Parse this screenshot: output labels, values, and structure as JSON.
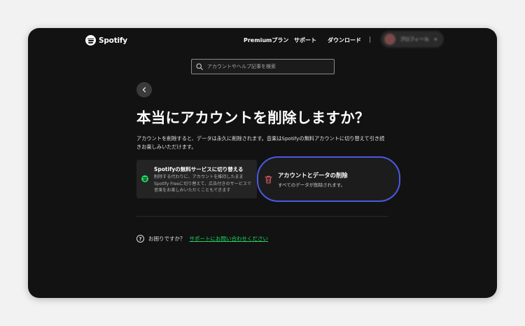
{
  "header": {
    "brand": "Spotify",
    "nav": [
      {
        "label": "Premiumプラン"
      },
      {
        "label": "サポート"
      },
      {
        "label": "ダウンロード"
      }
    ],
    "separator": "|",
    "account_name": "プロフィール",
    "account_caret": "▾"
  },
  "search": {
    "placeholder": "アカウントやヘルプ記事を検索"
  },
  "page": {
    "title": "本当にアカウントを削除しますか？",
    "description": "アカウントを削除すると、データは永久に削除されます。音楽はSpotifyの無料アカウントに切り替えて引き続きお楽しみいただけます。"
  },
  "options": {
    "free": {
      "title": "Spotifyの無料サービスに切り替える",
      "description": "削除する代わりに、アカウントを維持したままSpotify Freeに切り替えて、広告付きのサービスで音楽をお楽しみいただくこともできます"
    },
    "delete": {
      "title": "アカウントとデータの削除",
      "description": "すべてのデータが削除されます。"
    }
  },
  "help": {
    "icon": "?",
    "prompt": "お困りですか？",
    "link": "サポートにお問い合わせください"
  },
  "colors": {
    "background": "#121212",
    "accent_green": "#1ed760",
    "highlight_ring": "#4a59e3",
    "danger_icon": "#e35d6a"
  }
}
